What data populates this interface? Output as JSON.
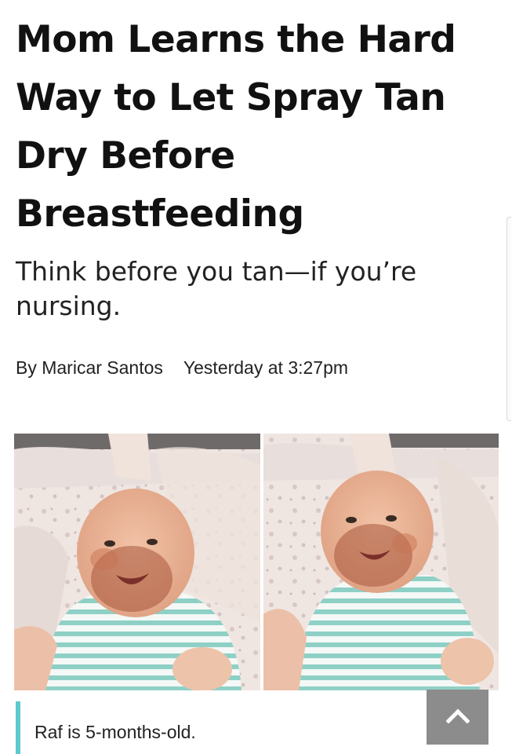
{
  "article": {
    "title": "Mom Learns the Hard Way to Let Spray Tan Dry Before Breastfeeding",
    "subtitle": "Think before you tan—if you’re nursing.",
    "author": "By Maricar Santos",
    "date": "Yesterday at 3:27pm",
    "caption": "Raf is 5-months-old."
  },
  "icons": {
    "back_to_top": "chevron-up-icon"
  },
  "colors": {
    "caption_accent": "#5ec9cf",
    "back_to_top_bg": "#8c8c8c",
    "onesie_stripe": "#8fd0c6"
  }
}
